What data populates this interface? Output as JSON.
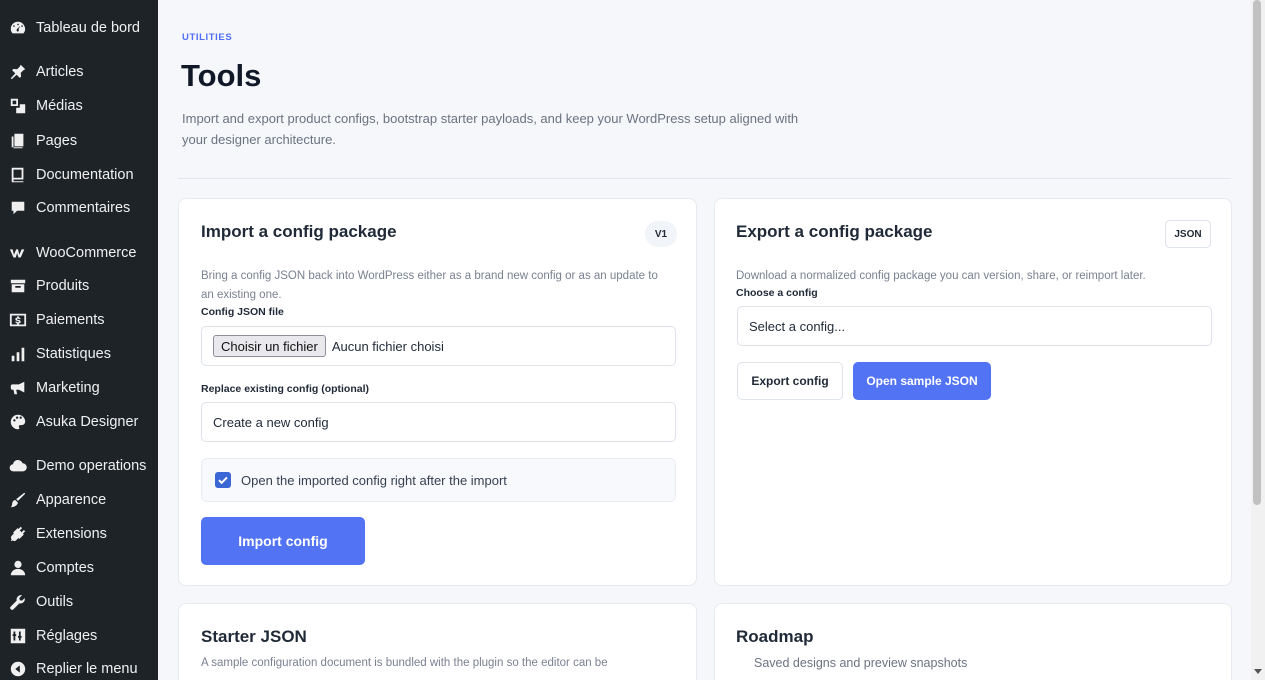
{
  "sidebar": {
    "items": [
      {
        "label": "Tableau de bord",
        "icon": "dashboard-icon"
      },
      {
        "label": "Articles",
        "icon": "pin-icon"
      },
      {
        "label": "Médias",
        "icon": "media-icon"
      },
      {
        "label": "Pages",
        "icon": "pages-icon"
      },
      {
        "label": "Documentation",
        "icon": "book-icon"
      },
      {
        "label": "Commentaires",
        "icon": "comment-icon"
      },
      {
        "label": "WooCommerce",
        "icon": "woocommerce-icon"
      },
      {
        "label": "Produits",
        "icon": "archive-icon"
      },
      {
        "label": "Paiements",
        "icon": "dollar-icon"
      },
      {
        "label": "Statistiques",
        "icon": "bar-chart-icon"
      },
      {
        "label": "Marketing",
        "icon": "megaphone-icon"
      },
      {
        "label": "Asuka Designer",
        "icon": "palette-icon"
      },
      {
        "label": "Demo operations",
        "icon": "cloud-icon"
      },
      {
        "label": "Apparence",
        "icon": "brush-icon"
      },
      {
        "label": "Extensions",
        "icon": "plug-icon"
      },
      {
        "label": "Comptes",
        "icon": "user-icon"
      },
      {
        "label": "Outils",
        "icon": "wrench-icon"
      },
      {
        "label": "Réglages",
        "icon": "settings-sliders-icon"
      },
      {
        "label": "Replier le menu",
        "icon": "collapse-icon"
      }
    ]
  },
  "header": {
    "eyebrow": "UTILITIES",
    "title": "Tools",
    "description": "Import and export product configs, bootstrap starter payloads, and keep your WordPress setup aligned with your designer architecture."
  },
  "import_card": {
    "title": "Import a config package",
    "badge": "V1",
    "description": "Bring a config JSON back into WordPress either as a brand new config or as an update to an existing one.",
    "file_label": "Config JSON file",
    "file_button": "Choisir un fichier",
    "file_status": "Aucun fichier choisi",
    "replace_label": "Replace existing config (optional)",
    "replace_value": "Create a new config",
    "checkbox_label": "Open the imported config right after the import",
    "checkbox_checked": true,
    "submit_label": "Import config"
  },
  "export_card": {
    "title": "Export a config package",
    "badge": "JSON",
    "description": "Download a normalized config package you can version, share, or reimport later.",
    "choose_label": "Choose a config",
    "select_value": "Select a config...",
    "export_button": "Export config",
    "sample_button": "Open sample JSON"
  },
  "starter_card": {
    "title": "Starter JSON",
    "description": "A sample configuration document is bundled with the plugin so the editor can be"
  },
  "roadmap_card": {
    "title": "Roadmap",
    "item": "Saved designs and preview snapshots"
  },
  "colors": {
    "accent": "#5373f5",
    "sidebar_bg": "#1d2327",
    "page_bg": "#f5f7fb"
  }
}
